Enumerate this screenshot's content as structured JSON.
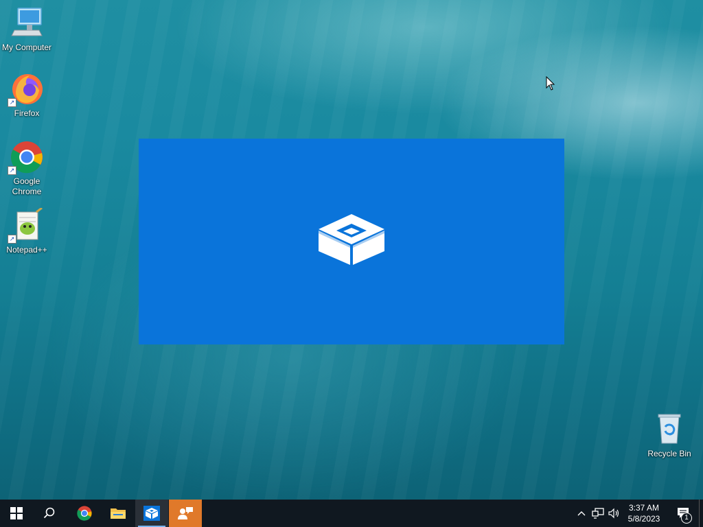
{
  "desktop": {
    "icons": [
      {
        "label": "My Computer",
        "icon": "computer-icon"
      },
      {
        "label": "Firefox",
        "icon": "firefox-icon"
      },
      {
        "label": "Google Chrome",
        "icon": "chrome-icon"
      },
      {
        "label": "Notepad++",
        "icon": "notepadpp-icon"
      },
      {
        "label": "Recycle Bin",
        "icon": "recycle-bin-icon"
      }
    ],
    "shortcut_arrow": "↗"
  },
  "splash": {
    "icon": "sandbox-box-icon",
    "color": "#0a74da"
  },
  "taskbar": {
    "items": [
      "start-icon",
      "search-icon",
      "chrome-icon",
      "file-explorer-icon",
      "sandbox-icon",
      "app-icon"
    ],
    "active_color": "#2a3038",
    "accent": "#7ab4ef"
  },
  "tray": {
    "time": "3:37 AM",
    "date": "5/8/2023",
    "notification_count": "1"
  }
}
